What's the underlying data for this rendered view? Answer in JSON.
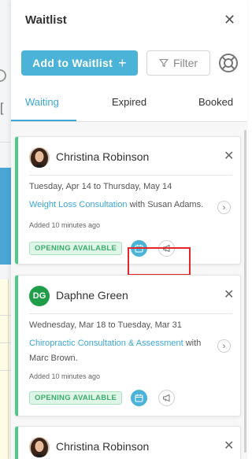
{
  "panel": {
    "title": "Waitlist",
    "close_icon": "close-icon"
  },
  "actions": {
    "add_label": "Add to Waitlist",
    "add_icon": "plus-icon",
    "filter_label": "Filter",
    "filter_icon": "funnel-icon",
    "help_icon": "lifebuoy-icon"
  },
  "tabs": [
    {
      "label": "Waiting",
      "active": true
    },
    {
      "label": "Expired",
      "active": false
    },
    {
      "label": "Booked",
      "active": false
    }
  ],
  "cards": [
    {
      "name": "Christina Robinson",
      "avatar": "photo",
      "date_range": "Tuesday, Apr 14 to Thursday, May 14",
      "service_link": "Weight Loss Consultation",
      "service_rest": " with Susan Adams.",
      "added": "Added 10 minutes ago",
      "status": "OPENING AVAILABLE"
    },
    {
      "name": "Daphne Green",
      "initials": "DG",
      "date_range": "Wednesday, Mar 18 to Tuesday, Mar 31",
      "service_link": "Chiropractic Consultation & Assessment",
      "service_rest": " with Marc Brown.",
      "added": "Added 10 minutes ago",
      "status": "OPENING AVAILABLE"
    },
    {
      "name": "Christina Robinson",
      "avatar": "photo"
    }
  ],
  "colors": {
    "accent": "#4bb3d8",
    "status_green": "#4fc988",
    "highlight_red": "#e5252a"
  }
}
